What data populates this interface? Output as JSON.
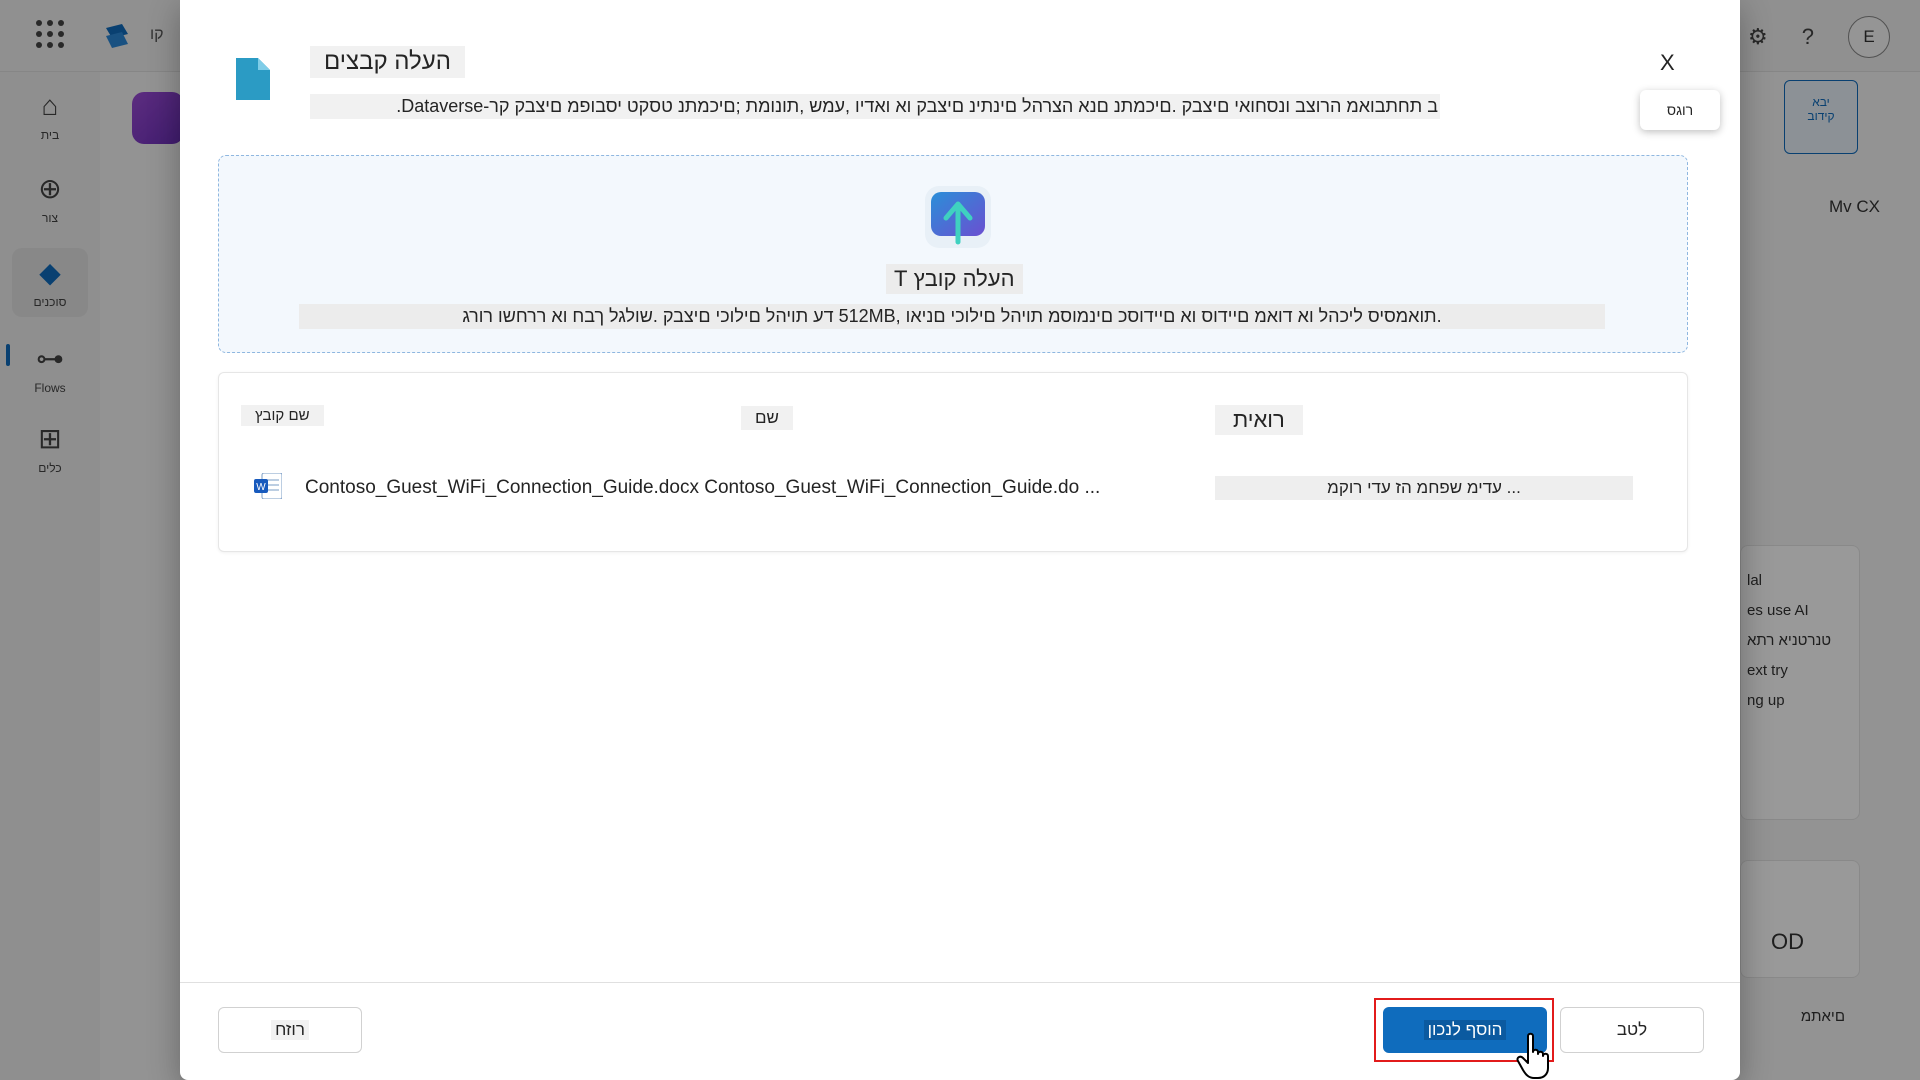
{
  "topbar": {
    "app_title": "קו",
    "avatar_initial": "E",
    "help_glyph": "?",
    "settings_glyph": "⚙"
  },
  "leftnav": {
    "items": [
      {
        "label": "בית",
        "icon": "home-icon",
        "glyph": "⌂"
      },
      {
        "label": "צור",
        "icon": "create-icon",
        "glyph": "⊕"
      },
      {
        "label": "סוכנים",
        "icon": "agents-icon",
        "glyph": "◆"
      },
      {
        "label": "Flows",
        "icon": "flows-icon",
        "glyph": "⊶"
      },
      {
        "label": "כלים",
        "icon": "tools-icon",
        "glyph": "⊞"
      }
    ]
  },
  "background": {
    "right_card_label": "יבא",
    "right_card_sub": "קידוב",
    "mv_label": "Mv CX",
    "snippets": [
      "lal",
      "es use AI",
      "טנרטניא רתא",
      "ext try",
      "ng up"
    ],
    "od_label": "OD",
    "bottom_right": "םיאתמ"
  },
  "dialog": {
    "title": "העלה קבצים",
    "description": "ב תחתבואמ הרוצב ונסחואי םיצבק .םיכמתנ םנא הצרהל םינתינ םיצבק וא ואדיו ,עמש ,תונומת ;םיכמתנ טסקט יסבופמ םיצבק קר-Dataverse.",
    "close_label": "X",
    "tooltip": "רוגס",
    "dropzone": {
      "title": "העלה קובץ T",
      "subtitle": ".תואמסיס ליכהל וא דואמ םיידוס וא םיידוסכ םינמוסמ תויהל םילוכי םניאו ,512MB דע תויהל םילוכי םיצבק .שולגל ךבח וא ררחשו רורג"
    },
    "table": {
      "col_size": "שם קובץ",
      "col_name": "שם",
      "col_status": "רואית",
      "rows": [
        {
          "file_name": "Contoso_Guest_WiFi_Connection_Guide.docx Contoso_Guest_WiFi_Connection_Guide.do ...",
          "status": "... עדימ שפחמ הז עדי רוקמ",
          "icon": "word-icon"
        }
      ]
    },
    "buttons": {
      "back": "רוזח",
      "primary": "הוסף לנכון",
      "cancel": "לטב"
    }
  },
  "colors": {
    "primary": "#0f6cbd",
    "highlight": "#e21b1b",
    "dropzone_border": "#8fb7e0"
  }
}
